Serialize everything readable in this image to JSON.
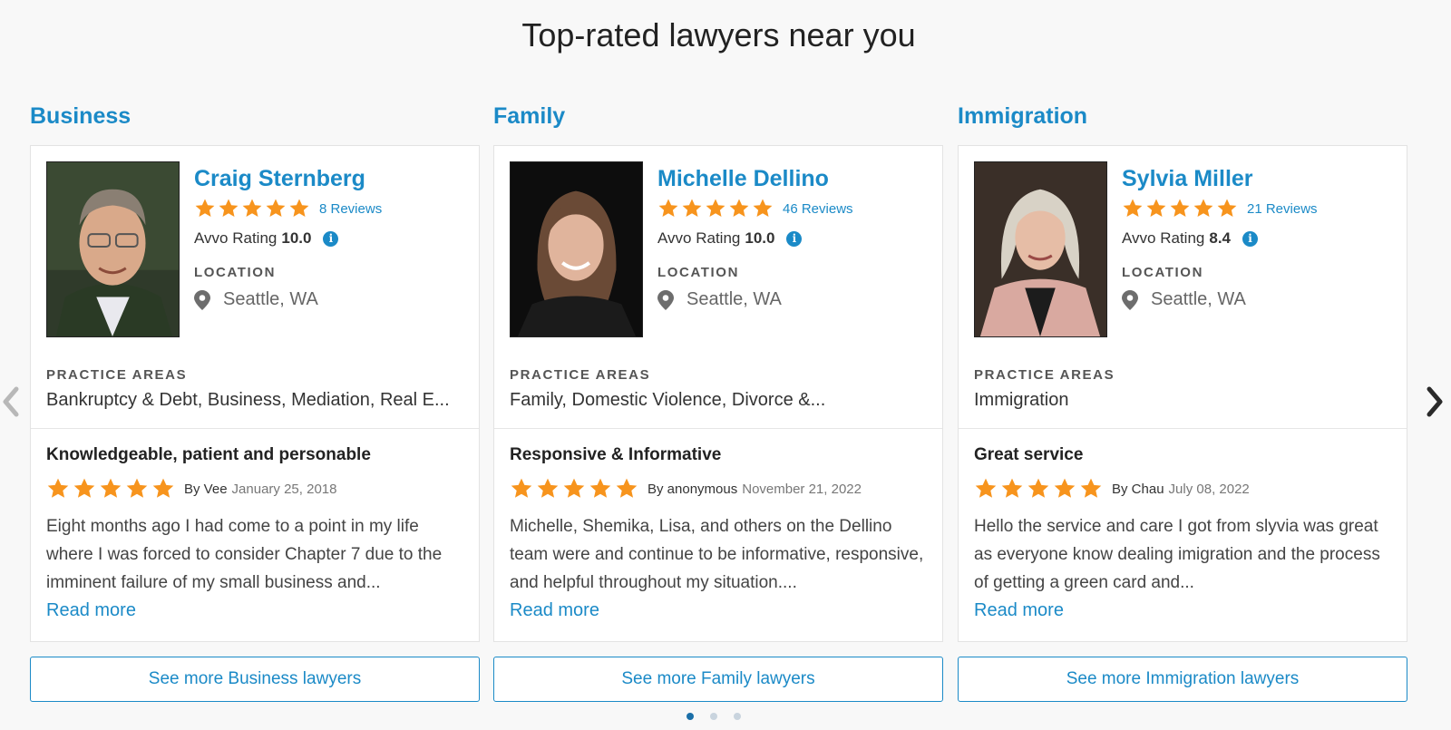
{
  "page_title": "Top-rated lawyers near you",
  "labels": {
    "location": "LOCATION",
    "practice_areas": "PRACTICE AREAS",
    "avvo_rating": "Avvo Rating",
    "read_more": "Read more"
  },
  "colors": {
    "accent": "#1b8ac7",
    "star": "#f7941d",
    "background": "#f8f8f8"
  },
  "columns": [
    {
      "category": "Business",
      "lawyer": {
        "name": "Craig Sternberg",
        "stars": 5,
        "reviews": "8 Reviews",
        "rating": "10.0",
        "location": "Seattle, WA",
        "practice_areas": "Bankruptcy & Debt, Business, Mediation, Real E..."
      },
      "review": {
        "title": "Knowledgeable, patient and personable",
        "stars": 5,
        "by": "By Vee",
        "date": "January 25, 2018",
        "text": "Eight months ago I had come to a point in my life where I was forced to consider Chapter 7 due to the imminent failure of my small business and..."
      },
      "see_more": "See more Business lawyers"
    },
    {
      "category": "Family",
      "lawyer": {
        "name": "Michelle Dellino",
        "stars": 5,
        "reviews": "46 Reviews",
        "rating": "10.0",
        "location": "Seattle, WA",
        "practice_areas": "Family, Domestic Violence, Divorce &..."
      },
      "review": {
        "title": "Responsive & Informative",
        "stars": 5,
        "by": "By anonymous",
        "date": "November 21, 2022",
        "text": "Michelle, Shemika, Lisa, and others on the Dellino team were and continue to be informative, responsive, and helpful throughout my situation...."
      },
      "see_more": "See more Family lawyers"
    },
    {
      "category": "Immigration",
      "lawyer": {
        "name": "Sylvia Miller",
        "stars": 5,
        "reviews": "21 Reviews",
        "rating": "8.4",
        "location": "Seattle, WA",
        "practice_areas": "Immigration"
      },
      "review": {
        "title": "Great service",
        "stars": 5,
        "by": "By Chau",
        "date": "July 08, 2022",
        "text": "Hello the service and care I got from slyvia was great as everyone know dealing imigration and the process of getting a green card and..."
      },
      "see_more": "See more Immigration lawyers"
    }
  ],
  "carousel": {
    "pages": 3,
    "active_page": 1,
    "prev_icon": "chevron-left-icon",
    "next_icon": "chevron-right-icon"
  }
}
